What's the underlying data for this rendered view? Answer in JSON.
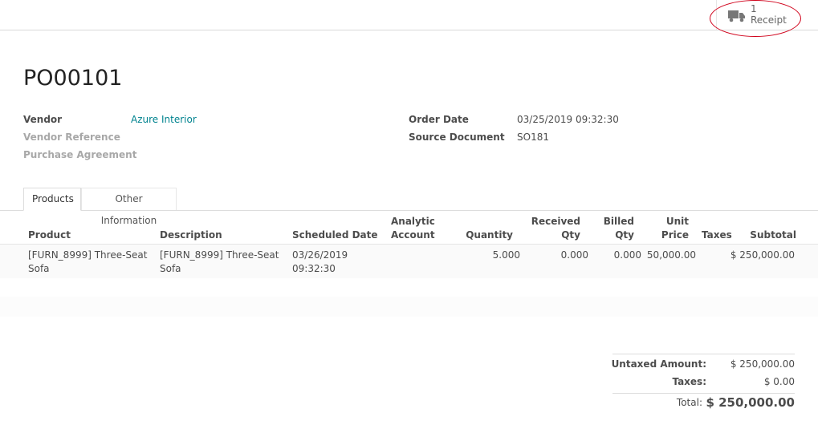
{
  "smart_button": {
    "count": "1",
    "label": "Receipt",
    "icon": "truck-icon",
    "highlight_color": "#d0021b"
  },
  "record": {
    "title": "PO00101"
  },
  "fields": {
    "vendor_label": "Vendor",
    "vendor_value": "Azure Interior",
    "vendor_reference_label": "Vendor Reference",
    "purchase_agreement_label": "Purchase Agreement",
    "order_date_label": "Order Date",
    "order_date_value": "03/25/2019 09:32:30",
    "source_document_label": "Source Document",
    "source_document_value": "SO181"
  },
  "tabs": [
    {
      "label": "Products",
      "active": true
    },
    {
      "label": "Other Information",
      "active": false
    }
  ],
  "table": {
    "columns": {
      "product": "Product",
      "description": "Description",
      "scheduled_date": "Scheduled Date",
      "analytic_1": "Analytic",
      "analytic_2": "Account",
      "quantity": "Quantity",
      "received_1": "Received",
      "received_2": "Qty",
      "billed_1": "Billed",
      "billed_2": "Qty",
      "unit_price_1": "Unit",
      "unit_price_2": "Price",
      "taxes": "Taxes",
      "subtotal": "Subtotal"
    },
    "rows": [
      {
        "product_1": "[FURN_8999] Three-Seat",
        "product_2": "Sofa",
        "description_1": "[FURN_8999] Three-Seat",
        "description_2": "Sofa",
        "scheduled_1": "03/26/2019",
        "scheduled_2": "09:32:30",
        "quantity": "5.000",
        "received": "0.000",
        "billed": "0.000",
        "unit_price": "50,000.00",
        "subtotal": "$ 250,000.00"
      }
    ]
  },
  "totals": {
    "untaxed_label": "Untaxed Amount:",
    "untaxed_value": "$ 250,000.00",
    "taxes_label": "Taxes:",
    "taxes_value": "$ 0.00",
    "total_label": "Total:",
    "total_value": "$ 250,000.00"
  }
}
